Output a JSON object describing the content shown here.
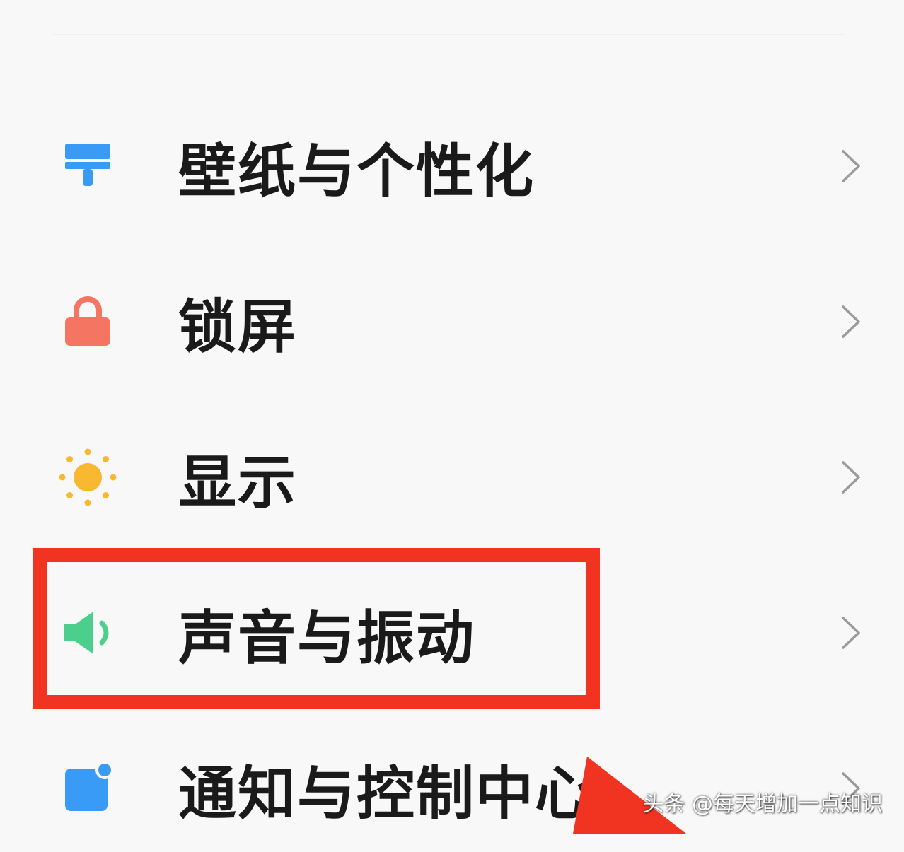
{
  "settings": {
    "items": [
      {
        "label": "壁纸与个性化",
        "icon": "paint-brush-icon",
        "icon_color": "#3a9bf6"
      },
      {
        "label": "锁屏",
        "icon": "lock-icon",
        "icon_color": "#f37562"
      },
      {
        "label": "显示",
        "icon": "sun-icon",
        "icon_color": "#f8b832"
      },
      {
        "label": "声音与振动",
        "icon": "speaker-icon",
        "icon_color": "#4ccf8c"
      },
      {
        "label": "通知与控制中心",
        "icon": "notification-icon",
        "icon_color": "#3a9bf6"
      }
    ]
  },
  "annotation": {
    "highlight_color": "#f03421",
    "highlighted_item": "声音与振动"
  },
  "watermark": "头条 @每天增加一点知识"
}
